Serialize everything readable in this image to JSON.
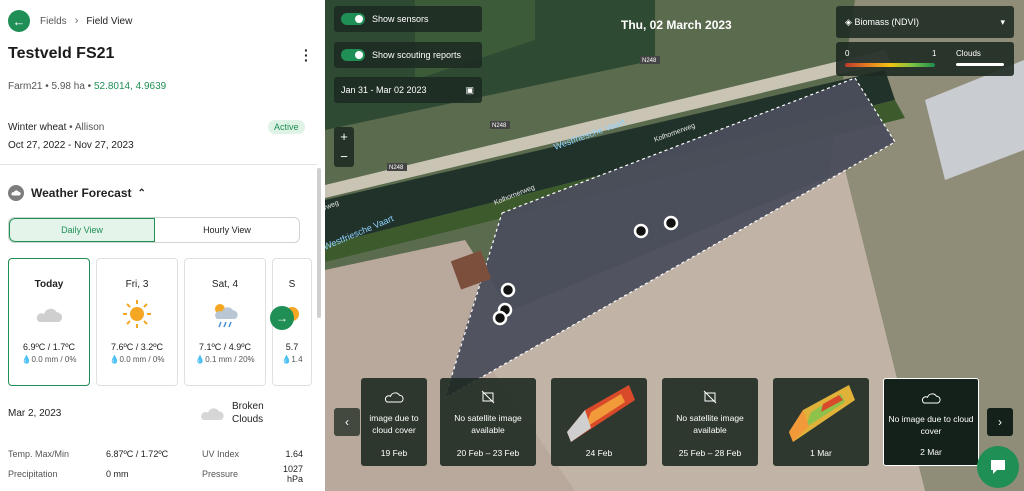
{
  "breadcrumb": {
    "parent": "Fields",
    "current": "Field View"
  },
  "field": {
    "name": "Testveld FS21",
    "farm": "Farm21",
    "area": "5.98 ha",
    "coords": "52.8014, 4.9639",
    "crop": "Winter wheat",
    "variety": "Allison",
    "status": "Active",
    "period": "Oct 27, 2022 - Nov 27, 2023"
  },
  "weather": {
    "title": "Weather Forecast",
    "tabs": [
      "Daily View",
      "Hourly View"
    ],
    "days": [
      {
        "label": "Today",
        "temp": "6.9ºC / 1.7ºC",
        "rain": "0.0 mm / 0%",
        "icon": "cloud-icon"
      },
      {
        "label": "Fri, 3",
        "temp": "7.6ºC / 3.2ºC",
        "rain": "0.0 mm / 0%",
        "icon": "sun-icon"
      },
      {
        "label": "Sat, 4",
        "temp": "7.1ºC / 4.9ºC",
        "rain": "0.1 mm / 20%",
        "icon": "rain-icon"
      },
      {
        "label": "S",
        "temp": "5.7",
        "rain": "1.4",
        "icon": "sun-icon"
      }
    ],
    "selected_date": "Mar 2, 2023",
    "condition": "Broken Clouds",
    "stats": {
      "temp_label": "Temp. Max/Min",
      "temp_value": "6.87ºC / 1.72ºC",
      "uv_label": "UV Index",
      "uv_value": "1.64",
      "precip_label": "Precipitation",
      "precip_value": "0 mm",
      "pressure_label": "Pressure",
      "pressure_value": "1027 hPa"
    }
  },
  "map": {
    "show_sensors": "Show sensors",
    "show_scouting": "Show scouting reports",
    "date_range": "Jan 31 - Mar 02 2023",
    "current_date": "Thu, 02 March 2023",
    "layer": "Biomass (NDVI)",
    "legend_min": "0",
    "legend_max": "1",
    "legend_clouds": "Clouds",
    "road_labels": [
      "N248",
      "N248",
      "N248"
    ],
    "water_labels": [
      "Westfriesche Vaart",
      "Westfriesche Vaart"
    ],
    "street_labels": [
      "Kolhornerweg",
      "Kolhornerweg",
      "rweg"
    ],
    "timeline": [
      {
        "msg": "image due to cloud cover",
        "date": "19 Feb",
        "type": "cloud"
      },
      {
        "msg": "No satellite image available",
        "date": "20 Feb – 23 Feb",
        "type": "none"
      },
      {
        "msg": "",
        "date": "24 Feb",
        "type": "image"
      },
      {
        "msg": "No satellite image available",
        "date": "25 Feb – 28 Feb",
        "type": "none"
      },
      {
        "msg": "",
        "date": "1 Mar",
        "type": "image"
      },
      {
        "msg": "No image due to cloud cover",
        "date": "2 Mar",
        "type": "cloud"
      }
    ]
  }
}
